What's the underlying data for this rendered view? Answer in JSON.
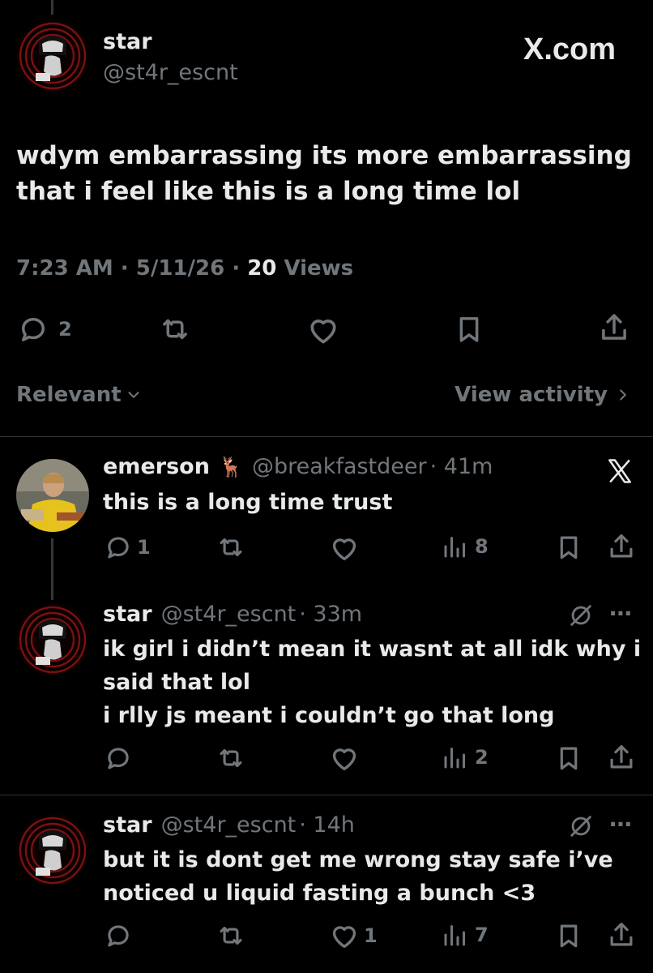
{
  "main_post": {
    "author_name": "star",
    "author_handle": "@st4r_escnt",
    "watermark": "X.com",
    "text_line1": "wdym embarrassing its more embarrassing",
    "text_line2": "that i feel like this is a long time lol",
    "time": "7:23 AM",
    "date": "5/11/26",
    "views_count": "20",
    "views_label": "Views",
    "sep": "·",
    "reply_count": "2"
  },
  "sort_bar": {
    "relevant_label": "Relevant",
    "view_activity_label": "View activity"
  },
  "replies": [
    {
      "name": "emerson",
      "emoji": "🦌",
      "handle": "@breakfastdeer",
      "time": "· 41m",
      "lines": [
        "this is a long time trust"
      ],
      "reply_count": "1",
      "like_count": "",
      "views": "8"
    },
    {
      "name": "star",
      "handle": "@st4r_escnt",
      "time": "· 33m",
      "lines": [
        "ik girl i didn’t mean it wasnt at all idk why i",
        "said that lol",
        "i rlly js meant i couldn’t go that long"
      ],
      "reply_count": "",
      "like_count": "",
      "views": "2"
    },
    {
      "name": "star",
      "handle": "@st4r_escnt",
      "time": "· 14h",
      "lines": [
        "but it is dont get me wrong stay safe i’ve",
        "noticed u liquid fasting a bunch <3"
      ],
      "reply_count": "",
      "like_count": "1",
      "views": "7"
    }
  ],
  "colors": {
    "background": "#000000",
    "text": "#e7e9ea",
    "muted": "#71767b",
    "divider": "#2f3336"
  },
  "icons": [
    "reply-icon",
    "repost-icon",
    "like-icon",
    "bookmark-icon",
    "share-icon",
    "views-icon",
    "grok-icon",
    "more-icon",
    "x-logo-icon",
    "chevron-down-icon",
    "chevron-right-icon"
  ]
}
